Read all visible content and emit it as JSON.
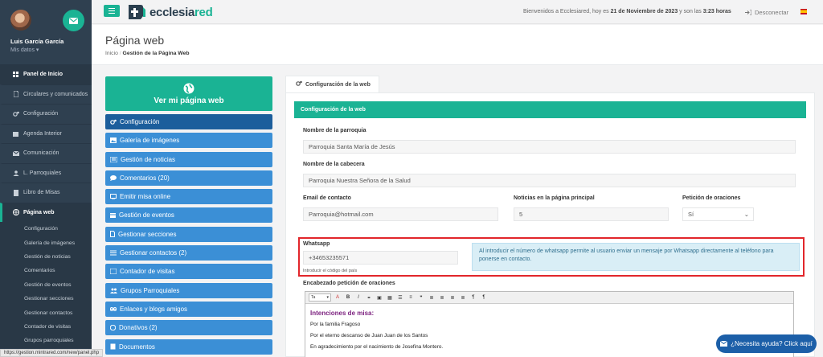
{
  "user": {
    "name": "Luis García García",
    "sub": "Mis datos"
  },
  "nav": [
    {
      "label": "Panel de Inicio",
      "icon": "th-large-icon",
      "state": "active"
    },
    {
      "label": "Circulares y comunicados",
      "icon": "file-icon",
      "state": ""
    },
    {
      "label": "Configuración",
      "icon": "gears-icon",
      "state": ""
    },
    {
      "label": "Agenda Interior",
      "icon": "calendar-icon",
      "state": ""
    },
    {
      "label": "Comunicación",
      "icon": "envelope-icon",
      "state": ""
    },
    {
      "label": "L. Parroquiales",
      "icon": "users-icon",
      "state": ""
    },
    {
      "label": "Libro de Misas",
      "icon": "book-icon",
      "state": ""
    },
    {
      "label": "Página web",
      "icon": "globe-icon",
      "state": "open"
    }
  ],
  "subnav": [
    "Configuración",
    "Galería de imágenes",
    "Gestión de noticias",
    "Comentarios",
    "Gestión de eventos",
    "Gestionar secciones",
    "Gestionar contactos",
    "Contador de visitas",
    "Grupos parroquiales"
  ],
  "header": {
    "logo_a": "ecclesia",
    "logo_b": "red",
    "welcome_pre": "Bienvenidos a Ecclesiared, hoy es ",
    "welcome_date": "21 de Noviembre de 2023",
    "welcome_mid": " y son las ",
    "welcome_time": "3:23 horas",
    "logout": "Desconectar"
  },
  "page": {
    "title": "Página web",
    "bc_home": "Inicio",
    "bc_sep": "/",
    "bc_current": "Gestión de la Página Web"
  },
  "leftmenu": {
    "ver_label": "Ver mi página web",
    "items": [
      {
        "label": "Configuración",
        "icon": "gears-icon",
        "selected": true
      },
      {
        "label": "Galería de imágenes",
        "icon": "image-icon",
        "selected": false
      },
      {
        "label": "Gestión de noticias",
        "icon": "newspaper-icon",
        "selected": false
      },
      {
        "label": "Comentarios (20)",
        "icon": "comment-icon",
        "selected": false
      },
      {
        "label": "Emitir misa online",
        "icon": "monitor-icon",
        "selected": false
      },
      {
        "label": "Gestión de eventos",
        "icon": "calendar-icon",
        "selected": false
      },
      {
        "label": "Gestionar secciones",
        "icon": "file-icon",
        "selected": false
      },
      {
        "label": "Gestionar contactos (2)",
        "icon": "list-icon",
        "selected": false
      },
      {
        "label": "Contador de visitas",
        "icon": "counter-icon",
        "selected": false
      },
      {
        "label": "Grupos Parroquiales",
        "icon": "users-icon",
        "selected": false
      },
      {
        "label": "Enlaces y blogs amigos",
        "icon": "link-icon",
        "selected": false
      },
      {
        "label": "Donativos (2)",
        "icon": "euro-icon",
        "selected": false
      },
      {
        "label": "Documentos",
        "icon": "document-icon",
        "selected": false
      }
    ]
  },
  "config": {
    "tab_label": "Configuración de la web",
    "panel_title": "Configuración de la web",
    "parroquia_label": "Nombre de la parroquia",
    "parroquia_value": "Parroquia Santa María de Jesús",
    "cabecera_label": "Nombre de la cabecera",
    "cabecera_value": "Parroquia Nuestra Señora de la Salud",
    "email_label": "Email de contacto",
    "email_value": "Parroquia@hotmail.com",
    "noticias_label": "Noticias en la página principal",
    "noticias_value": "5",
    "oraciones_label": "Petición de oraciones",
    "oraciones_value": "Sí",
    "whatsapp_label": "Whatsapp",
    "whatsapp_value": "+34653235571",
    "whatsapp_help": "Introducir el código del país",
    "whatsapp_info": "Al introducir el número de whatsapp permite al usuario enviar un mensaje por Whatsapp directamente al teléfono para ponerse en contacto.",
    "encabezado_label": "Encabezado petición de oraciones"
  },
  "editor": {
    "font_drop": "Ta",
    "heading": "Intenciones de misa:",
    "lines": [
      "Por la familia Fragoso",
      "Por el eterno descanso de Juan Juan de los Santos",
      "En agradecimiento por el nacimiento de Josefina Montero."
    ]
  },
  "help_btn": "¿Necesita ayuda? Click aquí",
  "status_url": "https://gestion.mintrared.com/new/panel.php",
  "colors": {
    "accent": "#1ab394",
    "sidebar": "#2f4050",
    "menu_blue": "#3b8fd6",
    "highlight": "#e2262b"
  }
}
